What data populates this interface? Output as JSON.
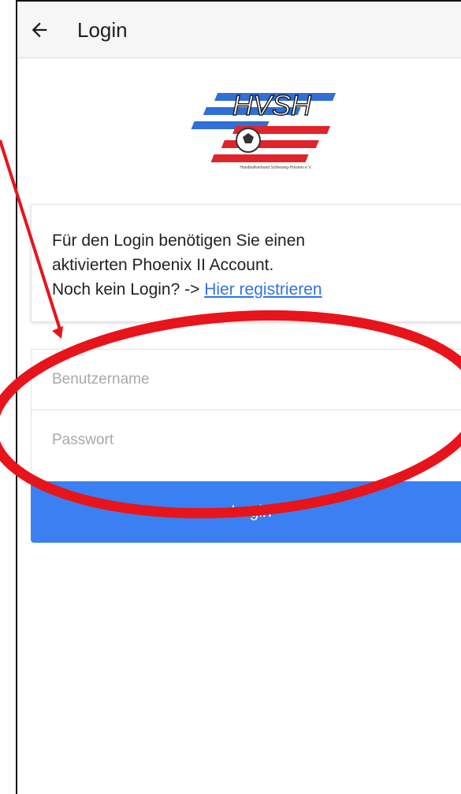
{
  "appbar": {
    "title": "Login",
    "back_icon": "arrow-left-icon"
  },
  "logo": {
    "text": "HVSH",
    "subtitle": "Handballverband Schleswig-Holstein e.V."
  },
  "info": {
    "line1": "Für den Login benötigen Sie einen",
    "line2": "aktivierten Phoenix II Account.",
    "line3_prefix": "Noch kein Login? -> ",
    "register_link": "Hier registrieren"
  },
  "form": {
    "username_placeholder": "Benutzername",
    "password_placeholder": "Passwort",
    "login_label": "Login"
  },
  "colors": {
    "accent": "#3a80f2",
    "link": "#2f73e8",
    "annotation": "#e8141b",
    "logo_blue": "#2f6fd6",
    "logo_red": "#e0242a"
  }
}
